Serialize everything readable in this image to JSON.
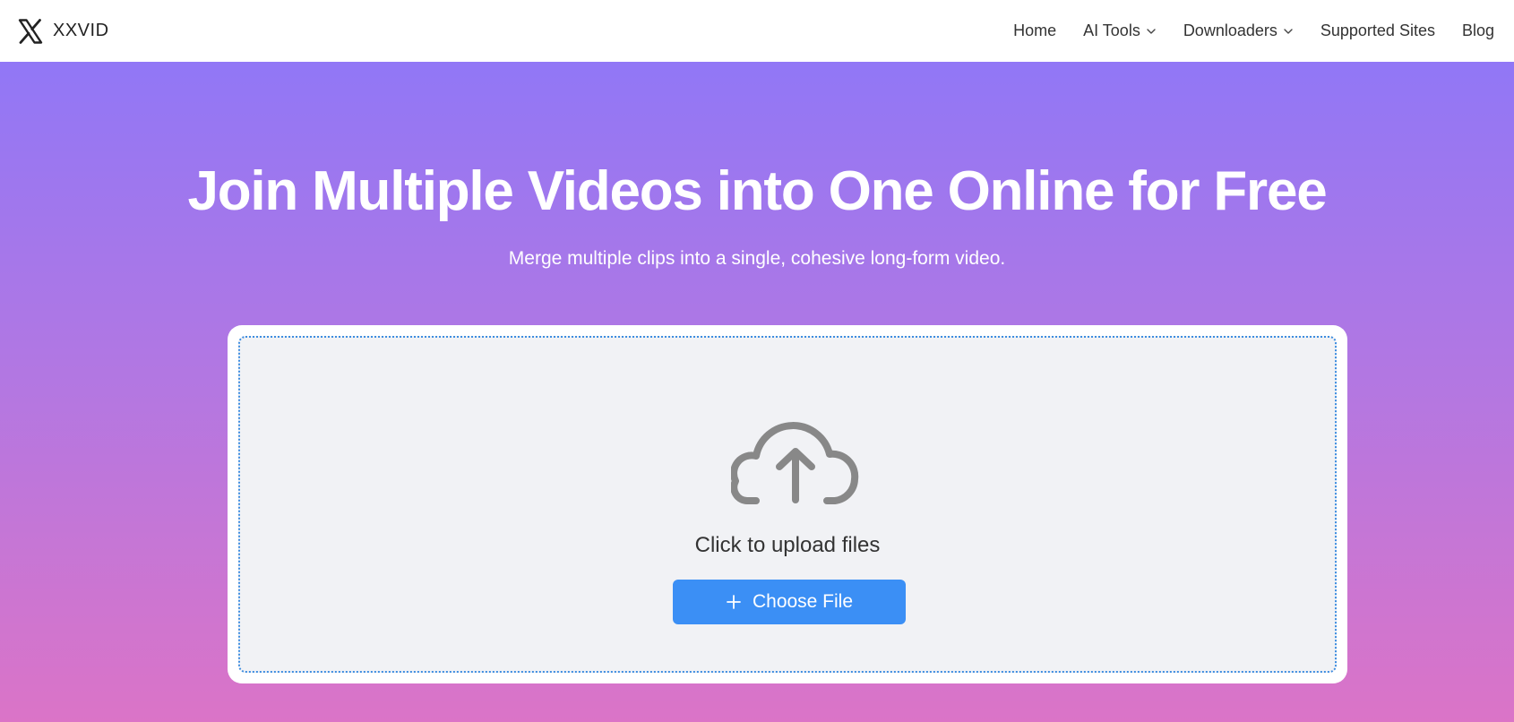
{
  "header": {
    "brand": {
      "logo_icon": "x-logo-icon",
      "name": "XXVID"
    },
    "nav": {
      "home": "Home",
      "ai_tools": "AI Tools",
      "downloaders": "Downloaders",
      "supported_sites": "Supported Sites",
      "blog": "Blog"
    }
  },
  "hero": {
    "title": "Join Multiple Videos into One Online for Free",
    "subtitle": "Merge multiple clips into a single, cohesive long-form video.",
    "gradient_colors": [
      "#9177f6",
      "#b477e1",
      "#db74c7"
    ]
  },
  "upload": {
    "icon": "cloud-upload-icon",
    "prompt": "Click to upload files",
    "button_icon": "plus-icon",
    "button_label": "Choose File",
    "button_color": "#3b8ff5",
    "dropzone_border_color": "#3d8de0"
  }
}
